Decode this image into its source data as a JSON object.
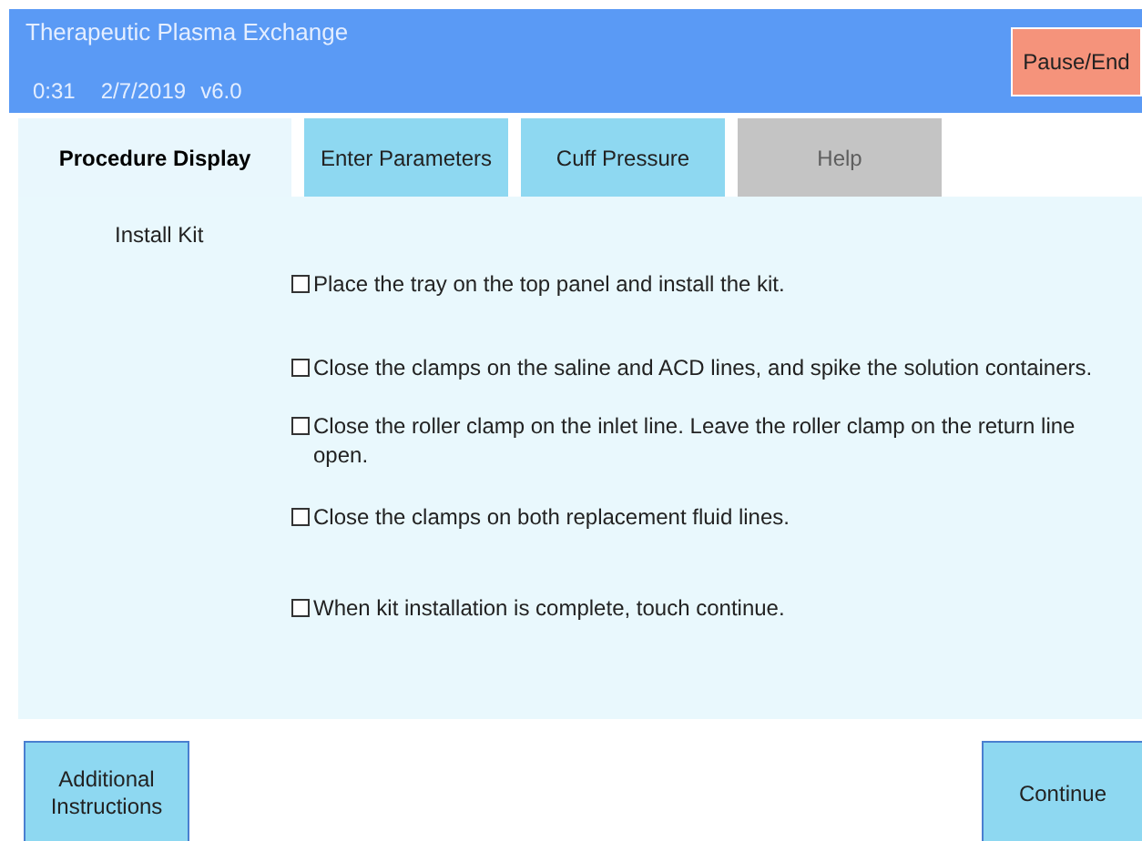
{
  "header": {
    "title": "Therapeutic Plasma Exchange",
    "time": "0:31",
    "date": "2/7/2019",
    "version": "v6.0",
    "pause_button": "Pause/End"
  },
  "tabs": [
    {
      "label": "Procedure Display",
      "selected": true,
      "disabled": false
    },
    {
      "label": "Enter Parameters",
      "selected": false,
      "disabled": false
    },
    {
      "label": "Cuff Pressure",
      "selected": false,
      "disabled": false
    },
    {
      "label": "Help",
      "selected": false,
      "disabled": true
    }
  ],
  "section_title": "Install Kit",
  "steps": [
    {
      "text": "Place the tray on the top panel and install the kit.",
      "checked": false
    },
    {
      "text": "Close the clamps on the saline and ACD lines, and spike the solution containers.",
      "checked": false
    },
    {
      "text": "Close the roller clamp on the inlet line. Leave the roller clamp on the return line open.",
      "checked": false
    },
    {
      "text": "Close the clamps on both replacement fluid lines.",
      "checked": false
    },
    {
      "text": "When kit installation is complete, touch continue.",
      "checked": false
    }
  ],
  "buttons": {
    "additional": "Additional Instructions",
    "continue": "Continue"
  }
}
